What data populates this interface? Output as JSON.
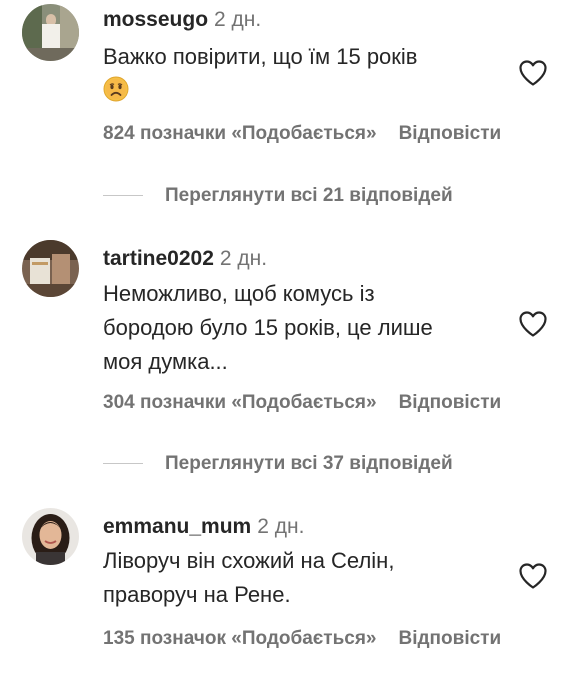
{
  "comments": [
    {
      "username": "mosseugo",
      "time": "2 дн.",
      "text": "Важко повірити, що їм 15 років",
      "emoji": "sad-face-emoji",
      "likes": "824 позначки «Подобається»",
      "reply": "Відповісти",
      "view_replies": "Переглянути всі 21 відповідей"
    },
    {
      "username": "tartine0202",
      "time": "2 дн.",
      "text_lines": [
        "Неможливо, щоб комусь із",
        "бородою було 15 років, це лише",
        "моя думка..."
      ],
      "likes": "304 позначки «Подобається»",
      "reply": "Відповісти",
      "view_replies": "Переглянути всі 37 відповідей"
    },
    {
      "username": "emmanu_mum",
      "time": "2 дн.",
      "text_lines": [
        "Ліворуч він схожий на Селін,",
        "праворуч на Рене."
      ],
      "likes": "135 позначок «Подобається»",
      "reply": "Відповісти"
    }
  ],
  "colors": {
    "primary_text": "#262626",
    "secondary_text": "#737373",
    "divider": "#c7c7c7"
  }
}
